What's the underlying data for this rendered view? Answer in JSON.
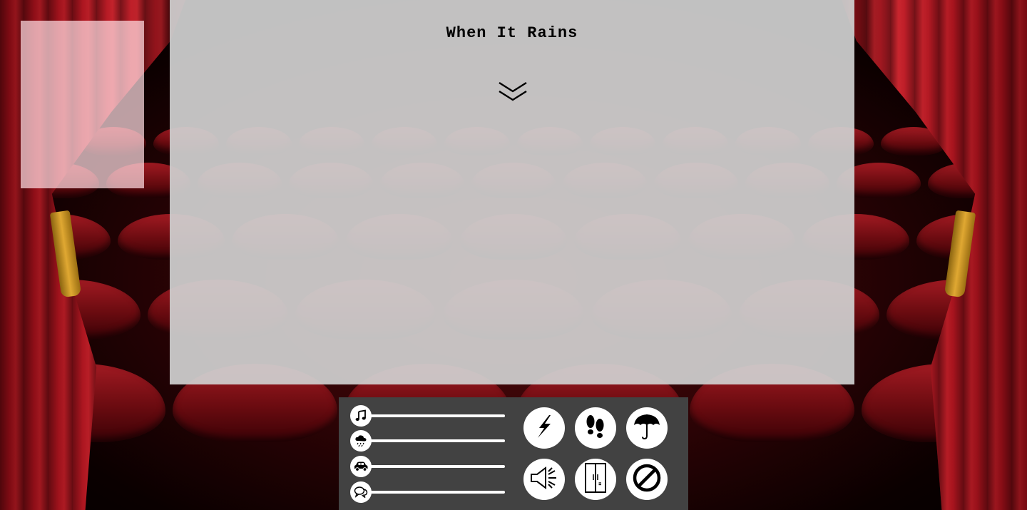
{
  "page": {
    "title": "When It Rains"
  },
  "icons": {
    "scroll": "double-chevron-down-icon",
    "sliders": [
      "music-note-icon",
      "rain-cloud-icon",
      "car-icon",
      "speech-bubbles-icon"
    ],
    "buttons": [
      "lightning-icon",
      "footsteps-icon",
      "umbrella-icon",
      "loudspeaker-icon",
      "door-icon",
      "stop-icon"
    ]
  },
  "colors": {
    "stage_panel": "#d0d0d0",
    "control_panel": "#424242",
    "curtain": "#a8141e",
    "tieback": "#e0a832",
    "icon_bg": "#ffffff"
  }
}
